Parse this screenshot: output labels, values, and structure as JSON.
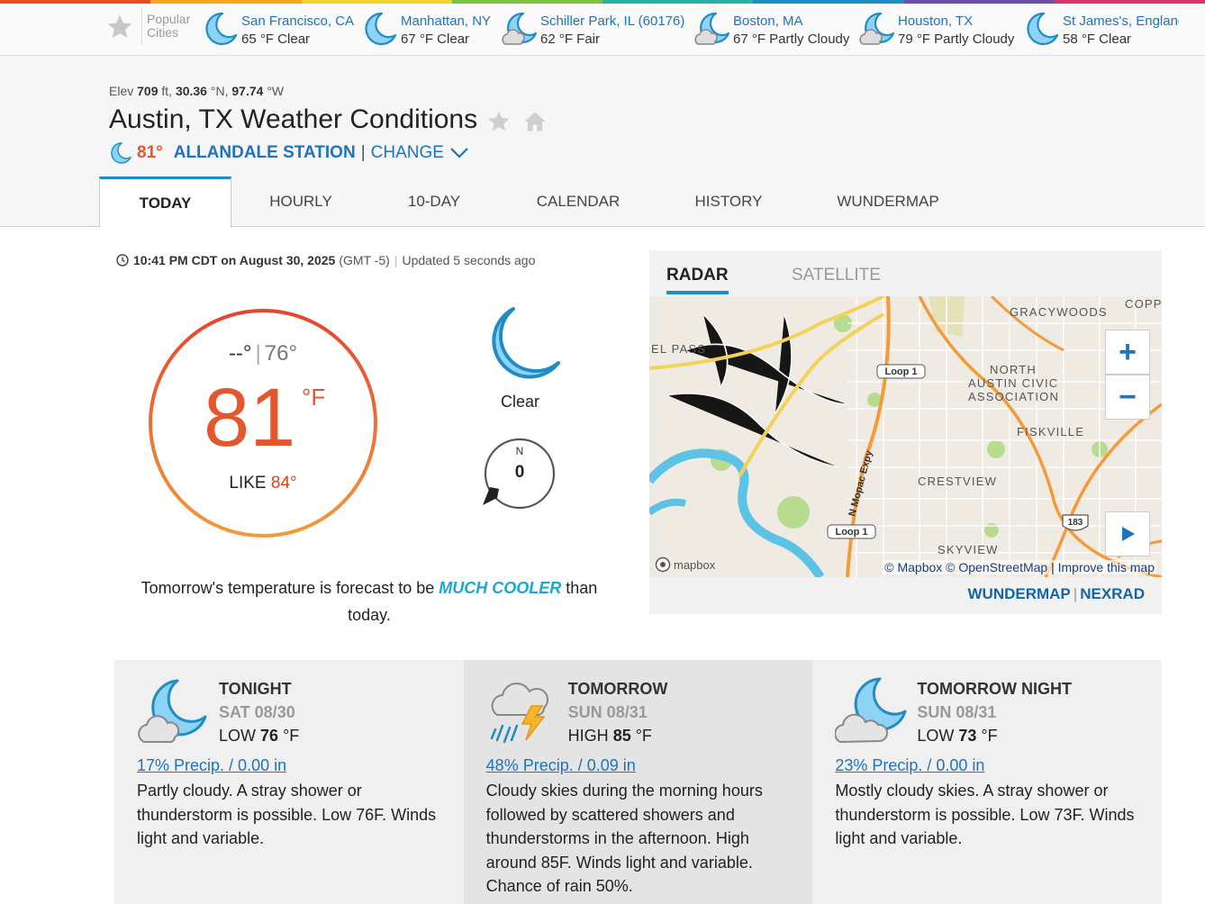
{
  "colors": {
    "accent": "#1e8cc5",
    "link": "#1e73be",
    "temp": "#e4572e",
    "rainbow": [
      "#e44d26",
      "#f6a623",
      "#f2d22e",
      "#7cc142",
      "#2ab0a8",
      "#1e8cc5",
      "#6b4fa2",
      "#d6336c"
    ]
  },
  "popular": {
    "label_line1": "Popular",
    "label_line2": "Cities",
    "star_icon": "star-icon",
    "cities": [
      {
        "name": "San Francisco, CA",
        "cond": "65 °F Clear",
        "icon": "moon-icon"
      },
      {
        "name": "Manhattan, NY",
        "cond": "67 °F Clear",
        "icon": "moon-icon"
      },
      {
        "name": "Schiller Park, IL (60176)",
        "cond": "62 °F Fair",
        "icon": "moon-cloud-icon"
      },
      {
        "name": "Boston, MA",
        "cond": "67 °F Partly Cloudy",
        "icon": "moon-cloud-icon"
      },
      {
        "name": "Houston, TX",
        "cond": "79 °F Partly Cloudy",
        "icon": "moon-cloud-icon"
      },
      {
        "name": "St James's, England",
        "cond": "58 °F Clear",
        "icon": "moon-icon"
      }
    ]
  },
  "location": {
    "elev_label": "Elev",
    "elev_value": "709",
    "elev_unit": "ft,",
    "lat": "30.36",
    "lat_unit": "°N,",
    "lon": "97.74",
    "lon_unit": "°W",
    "title": "Austin, TX Weather Conditions",
    "station_temp": "81°",
    "station_name": "ALLANDALE STATION",
    "station_sep": "|",
    "change_label": "CHANGE"
  },
  "tabs": [
    "TODAY",
    "HOURLY",
    "10-DAY",
    "CALENDAR",
    "HISTORY",
    "WUNDERMAP"
  ],
  "current": {
    "time": "10:41 PM CDT on August 30, 2025",
    "tz": "(GMT -5)",
    "updated": "Updated 5 seconds ago",
    "hi": "--°",
    "lo": "76°",
    "temp": "81",
    "unit": "°F",
    "feels_label": "LIKE",
    "feels_value": "84°",
    "condition": "Clear",
    "wind_dir": "N",
    "wind_speed": "0",
    "note_before": "Tomorrow's temperature is forecast to be",
    "note_emph": "MUCH COOLER",
    "note_after": "than today."
  },
  "radar": {
    "tab_radar": "RADAR",
    "tab_satellite": "SATELLITE",
    "zoom_in": "+",
    "zoom_out": "−",
    "attr_mapbox": "© Mapbox",
    "attr_osm": "© OpenStreetMap",
    "attr_improve": "Improve this map",
    "attr_sep": "|",
    "logo": "mapbox",
    "link_wundermap": "WUNDERMAP",
    "link_nexrad": "NEXRAD",
    "links_sep": "|",
    "labels": {
      "gracywoods": "GRACYWOODS",
      "north_austin": "NORTH",
      "austin_civic": "AUSTIN CIVIC",
      "association": "ASSOCIATION",
      "fiskville": "FISKVILLE",
      "crestview": "CRESTVIEW",
      "skyview": "SKYVIEW",
      "el_pass": "EL PASS",
      "copper": "COPPE",
      "loop1a": "Loop 1",
      "loop1b": "Loop 1",
      "mopac": "N Mopac Expy",
      "hwy183": "183"
    }
  },
  "forecast": [
    {
      "day": "TONIGHT",
      "date": "SAT 08/30",
      "temp_label": "LOW",
      "temp": "76",
      "unit": "°F",
      "precip": "17% Precip. / 0.00 in",
      "desc": "Partly cloudy. A stray shower or thunderstorm is possible. Low 76F. Winds light and variable.",
      "icon": "moon-cloud-icon"
    },
    {
      "day": "TOMORROW",
      "date": "SUN 08/31",
      "temp_label": "HIGH",
      "temp": "85",
      "unit": "°F",
      "precip": "48% Precip. / 0.09 in",
      "desc": "Cloudy skies during the morning hours followed by scattered showers and thunderstorms in the afternoon. High around 85F. Winds light and variable. Chance of rain 50%.",
      "icon": "thunderstorm-icon"
    },
    {
      "day": "TOMORROW NIGHT",
      "date": "SUN 08/31",
      "temp_label": "LOW",
      "temp": "73",
      "unit": "°F",
      "precip": "23% Precip. / 0.00 in",
      "desc": "Mostly cloudy skies. A stray shower or thunderstorm is possible. Low 73F. Winds light and variable.",
      "icon": "moon-cloud-icon"
    }
  ]
}
